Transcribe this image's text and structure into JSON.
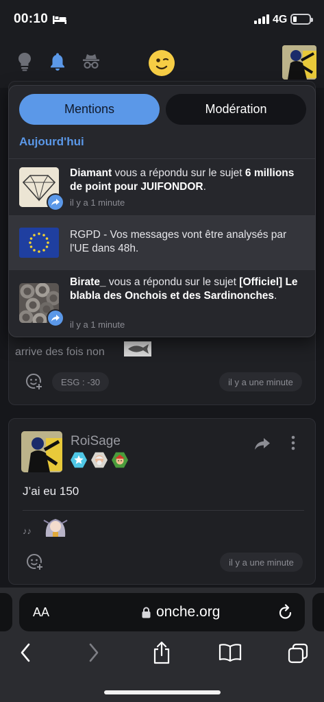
{
  "status": {
    "time": "00:10",
    "network": "4G"
  },
  "notifications": {
    "tabs": [
      {
        "label": "Mentions"
      },
      {
        "label": "Modération"
      }
    ],
    "section": "Aujourd'hui",
    "items": [
      {
        "user": "Diamant",
        "action": " vous a répondu sur le sujet ",
        "topic": "6 millions de point pour JUIFONDOR",
        "end": ".",
        "time": "il y a 1 minute"
      },
      {
        "text": "RGPD - Vos messages vont être analysés par l'UE dans 48h."
      },
      {
        "user": "Birate_",
        "action": " vous a répondu sur le sujet ",
        "topic": "[Officiel] Le blabla des Onchois et des Sardinonches",
        "end": ".",
        "time": "il y a 1 minute"
      }
    ]
  },
  "post1": {
    "text_cut": "arrive des fois non",
    "esg": "ESG : -30",
    "time": "il y a une minute"
  },
  "post2": {
    "username": "RoiSage",
    "text": "J’ai eu 150",
    "signature": "♪♪",
    "time": "il y a une minute"
  },
  "browser": {
    "aa": "AA",
    "url": "onche.org"
  },
  "colors": {
    "accent": "#5b98e8",
    "background": "#16171b",
    "card": "#1f2024",
    "dropdown": "#26272c"
  },
  "icons": [
    "bed-icon",
    "lightbulb-icon",
    "bell-icon",
    "incognito-icon",
    "smiley-icon",
    "share-icon",
    "reply-arrow-icon",
    "more-icon",
    "emoji-add-icon",
    "lock-icon",
    "reload-icon",
    "back-icon",
    "forward-icon",
    "bookmarks-icon",
    "tabs-icon"
  ]
}
